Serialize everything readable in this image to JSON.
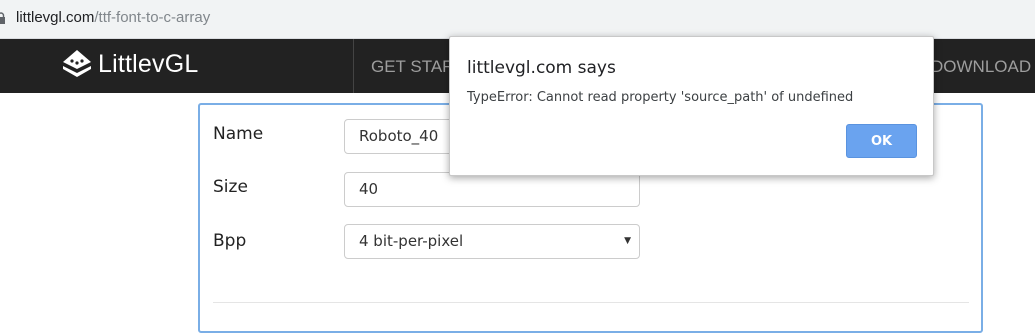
{
  "browser": {
    "url_domain": "littlevgl.com",
    "url_path": "/ttf-font-to-c-array"
  },
  "navbar": {
    "brand": "LittlevGL",
    "items": [
      {
        "label": "GET START"
      },
      {
        "label": "DOWNLOAD"
      }
    ]
  },
  "form": {
    "name_label": "Name",
    "name_value": "Roboto_40",
    "size_label": "Size",
    "size_value": "40",
    "bpp_label": "Bpp",
    "bpp_value": "4 bit-per-pixel"
  },
  "dialog": {
    "title": "littlevgl.com says",
    "message": "TypeError: Cannot read property 'source_path' of undefined",
    "ok_label": "OK"
  },
  "colors": {
    "navbar_bg": "#222222",
    "ok_button": "#6aa3ef",
    "panel_border": "#7aaee6"
  }
}
